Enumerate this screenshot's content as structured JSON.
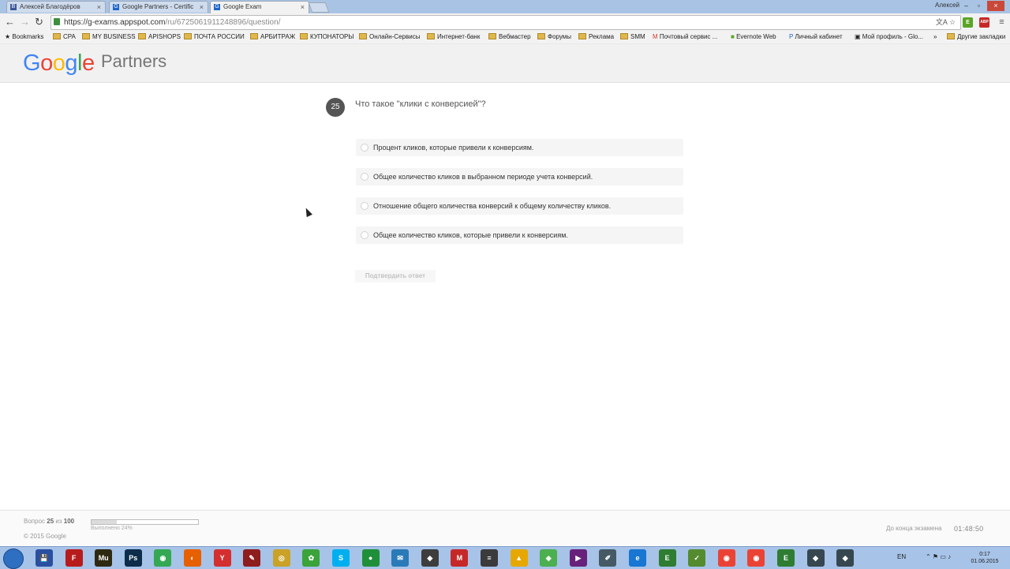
{
  "browser": {
    "tabs": [
      {
        "label": "Алексей Благодёров",
        "favicon": "В",
        "active": false
      },
      {
        "label": "Google Partners - Certific",
        "favicon": "G",
        "active": false
      },
      {
        "label": "Google Exam",
        "favicon": "G",
        "active": true
      }
    ],
    "window_user": "Алексей",
    "url_host": "https://g-exams.appspot.com",
    "url_path": "/ru/6725061911248896/question/",
    "extensions": [
      {
        "name": "evernote-icon",
        "label": "E",
        "color": "#5ba525"
      },
      {
        "name": "adblock-icon",
        "label": "ABP",
        "color": "#c62828"
      }
    ],
    "bookmarks": [
      "Bookmarks",
      "CPA",
      "MY BUSINESS",
      "APISHOPS",
      "ПОЧТА РОССИИ",
      "АРБИТРАЖ",
      "КУПОНАТОРЫ",
      "Онлайн-Сервисы",
      "Интернет-банк",
      "Вебмастер",
      "Форумы",
      "Реклама",
      "SMM",
      "Почтовый сервис ...",
      "Evernote Web",
      "Личный кабинет",
      "Мой профиль - Glo...",
      "»",
      "Другие закладки"
    ]
  },
  "site": {
    "logo": [
      "G",
      "o",
      "o",
      "g",
      "l",
      "e"
    ],
    "brand": "Partners",
    "question": {
      "number": "25",
      "text": "Что такое \"клики с конверсией\"?",
      "options": [
        "Процент кликов, которые привели к конверсиям.",
        "Общее количество кликов в выбранном периоде учета конверсий.",
        "Отношение общего количества конверсий к общему количеству кликов.",
        "Общее количество кликов, которые привели к конверсиям."
      ],
      "submit_label": "Подтвердить ответ"
    },
    "footer": {
      "progress_prefix": "Вопрос",
      "current": "25",
      "of": "из",
      "total": "100",
      "progress_fraction": 0.24,
      "progress_label": "Выполнено 24%",
      "copyright": "© 2015 Google",
      "timer_label": "До конца экзамена",
      "timer": "01:48:50"
    }
  },
  "taskbar": {
    "apps": [
      {
        "name": "save-icon",
        "label": "💾",
        "color": "#2b4fa0"
      },
      {
        "name": "filezilla-icon",
        "label": "F",
        "color": "#b71c1c"
      },
      {
        "name": "muse-icon",
        "label": "Mu",
        "color": "#2e2a12"
      },
      {
        "name": "photoshop-icon",
        "label": "Ps",
        "color": "#0d2d4a"
      },
      {
        "name": "chrome-icon",
        "label": "◉",
        "color": "#34a853"
      },
      {
        "name": "firefox-icon",
        "label": "◐",
        "color": "#e66000"
      },
      {
        "name": "yandex-icon",
        "label": "Y",
        "color": "#d32f2f"
      },
      {
        "name": "pen-icon",
        "label": "✎",
        "color": "#8e1d1d"
      },
      {
        "name": "app-icon-1",
        "label": "◎",
        "color": "#c9a227"
      },
      {
        "name": "icq-icon",
        "label": "✿",
        "color": "#3aa33a"
      },
      {
        "name": "skype-icon",
        "label": "S",
        "color": "#00aff0"
      },
      {
        "name": "app-icon-2",
        "label": "●",
        "color": "#1f8f3a"
      },
      {
        "name": "mail-icon",
        "label": "✉",
        "color": "#2a7ab8"
      },
      {
        "name": "app-icon-3",
        "label": "◆",
        "color": "#3d3d3d"
      },
      {
        "name": "app-icon-4",
        "label": "M",
        "color": "#c62828"
      },
      {
        "name": "app-icon-5",
        "label": "≡",
        "color": "#3b3b3b"
      },
      {
        "name": "app-icon-6",
        "label": "▲",
        "color": "#e6a800"
      },
      {
        "name": "app-icon-7",
        "label": "◈",
        "color": "#4caf50"
      },
      {
        "name": "visual-studio-icon",
        "label": "▶",
        "color": "#68217a"
      },
      {
        "name": "app-icon-8",
        "label": "✐",
        "color": "#455a64"
      },
      {
        "name": "ie-icon",
        "label": "e",
        "color": "#1976d2"
      },
      {
        "name": "evernote-taskbar-icon",
        "label": "E",
        "color": "#2e7d32"
      },
      {
        "name": "app-icon-9",
        "label": "✓",
        "color": "#558b2f"
      },
      {
        "name": "chrome-icon-2",
        "label": "◉",
        "color": "#ea4335"
      },
      {
        "name": "chrome-icon-3",
        "label": "◉",
        "color": "#ea4335"
      },
      {
        "name": "evernote-taskbar-icon-2",
        "label": "E",
        "color": "#2e7d32"
      },
      {
        "name": "app-icon-10",
        "label": "◆",
        "color": "#37474f"
      },
      {
        "name": "app-icon-11",
        "label": "◆",
        "color": "#37474f"
      }
    ],
    "lang": "EN",
    "time": "0:17",
    "date": "01.06.2015"
  }
}
